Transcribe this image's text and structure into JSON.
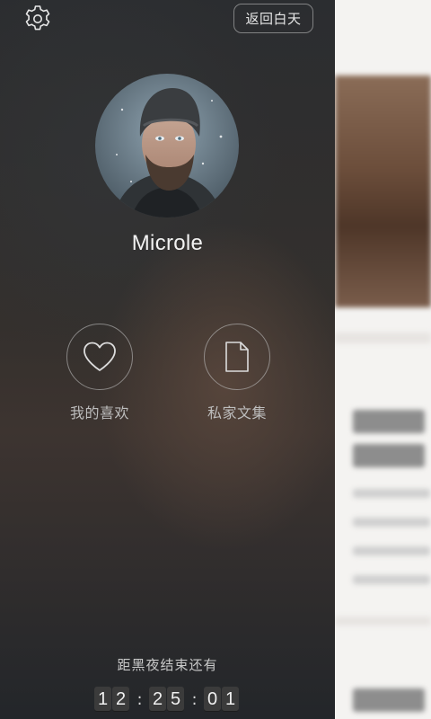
{
  "header": {
    "settings_icon": "gear-icon",
    "return_day_label": "返回白天"
  },
  "profile": {
    "avatar": "user-avatar",
    "username": "Microle"
  },
  "actions": [
    {
      "icon": "heart-icon",
      "label": "我的喜欢"
    },
    {
      "icon": "document-icon",
      "label": "私家文集"
    }
  ],
  "countdown": {
    "title": "距黑夜结束还有",
    "digits": [
      "1",
      "2",
      "2",
      "5",
      "0",
      "1"
    ],
    "separator": ":"
  },
  "colors": {
    "drawer_bg": "#2e2d2c",
    "text_light": "#f2f2f2",
    "text_muted": "#bdbdbd",
    "digit_bg": "#3b3b3b"
  }
}
